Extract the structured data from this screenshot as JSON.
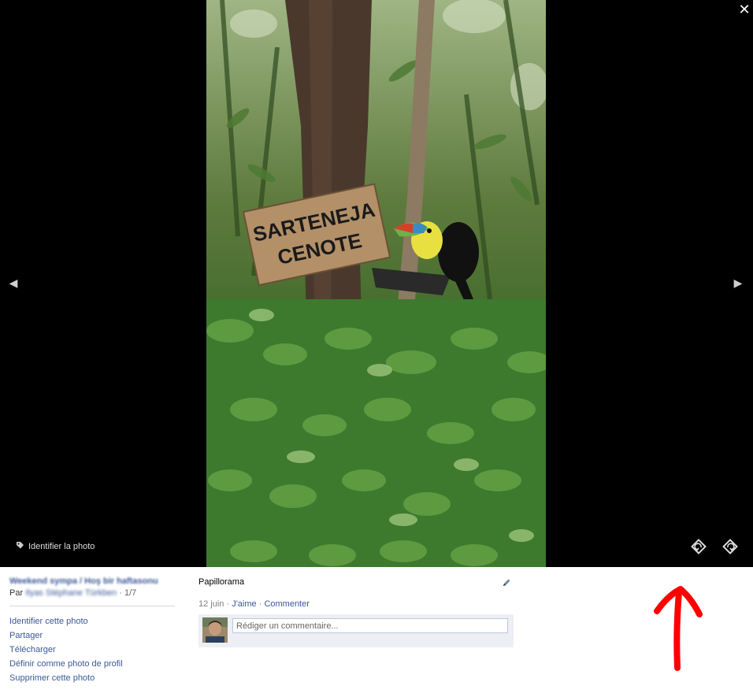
{
  "viewer": {
    "close_glyph": "✕",
    "prev_glyph": "◀",
    "next_glyph": "▶",
    "tag_label": "Identifier la photo",
    "sign_text_line1": "SARTENEJA",
    "sign_text_line2": "CENOTE"
  },
  "sidebar": {
    "album_title": "Weekend sympa / Hoş bir haftasonu",
    "by_prefix": "Par",
    "author": "Ilyas Stéphane Türkben",
    "count": " · 1/7",
    "actions": [
      "Identifier cette photo",
      "Partager",
      "Télécharger",
      "Définir comme photo de profil",
      "Supprimer cette photo"
    ]
  },
  "post": {
    "caption": "Papillorama",
    "date": "12 juin",
    "like": "J'aime",
    "comment": "Commenter",
    "comment_placeholder": "Rédiger un commentaire..."
  },
  "icons": {
    "tag": "tag-icon",
    "rotate_left": "rotate-left-icon",
    "rotate_right": "rotate-right-icon",
    "pencil": "pencil-icon"
  },
  "colors": {
    "link": "#3b5998",
    "stage": "#000000",
    "annotation": "#ff0000"
  }
}
